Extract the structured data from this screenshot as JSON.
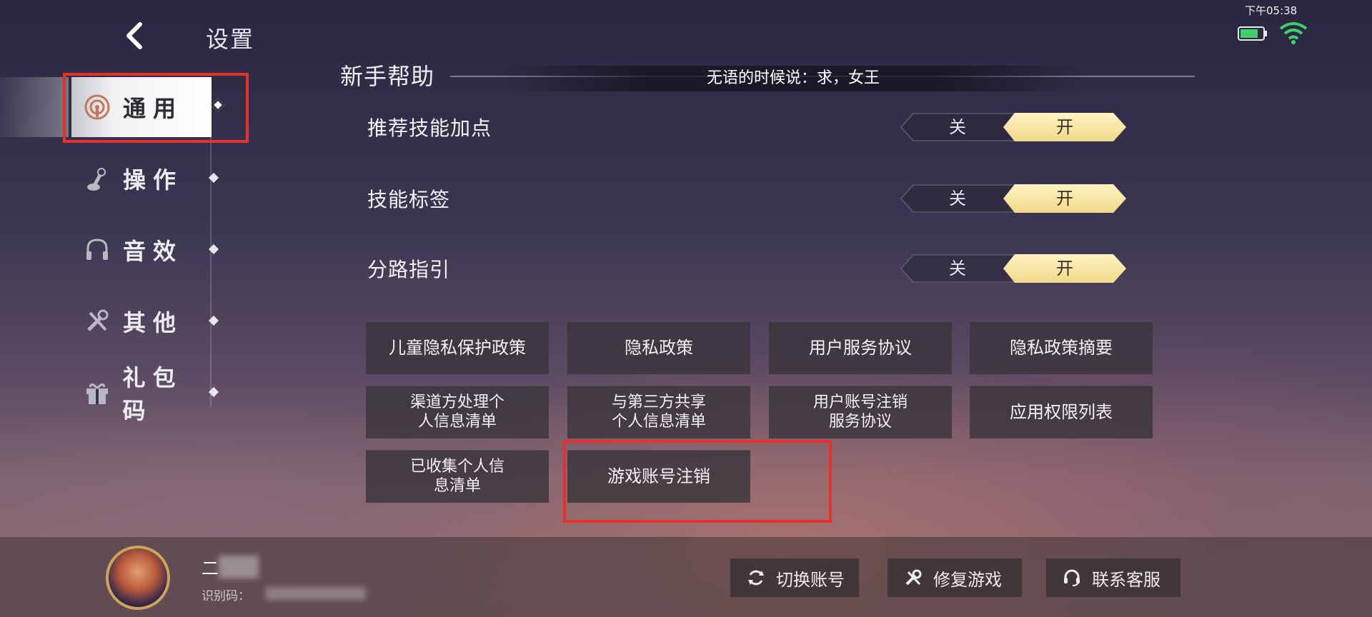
{
  "status_bar": {
    "time": "下午05:38"
  },
  "header": {
    "title": "设置"
  },
  "sidebar": {
    "items": [
      {
        "label": "通用",
        "icon": "general-icon",
        "active": true
      },
      {
        "label": "操作",
        "icon": "joystick-icon",
        "active": false
      },
      {
        "label": "音效",
        "icon": "headphones-icon",
        "active": false
      },
      {
        "label": "其他",
        "icon": "tools-icon",
        "active": false
      },
      {
        "label": "礼包码",
        "icon": "gift-icon",
        "active": false
      }
    ]
  },
  "main": {
    "section_title": "新手帮助",
    "tip": "无语的时候说：求，女王",
    "settings": [
      {
        "label": "推荐技能加点",
        "off": "关",
        "on": "开",
        "value": "开"
      },
      {
        "label": "技能标签",
        "off": "关",
        "on": "开",
        "value": "开"
      },
      {
        "label": "分路指引",
        "off": "关",
        "on": "开",
        "value": "开"
      }
    ],
    "docs": [
      {
        "line1": "儿童隐私保护政策",
        "line2": ""
      },
      {
        "line1": "隐私政策",
        "line2": ""
      },
      {
        "line1": "用户服务协议",
        "line2": ""
      },
      {
        "line1": "隐私政策摘要",
        "line2": ""
      },
      {
        "line1": "渠道方处理个",
        "line2": "人信息清单"
      },
      {
        "line1": "与第三方共享",
        "line2": "个人信息清单"
      },
      {
        "line1": "用户账号注销",
        "line2": "服务协议"
      },
      {
        "line1": "应用权限列表",
        "line2": ""
      },
      {
        "line1": "已收集个人信",
        "line2": "息清单"
      },
      {
        "line1": "游戏账号注销",
        "line2": ""
      }
    ]
  },
  "footer": {
    "user_name_prefix": "二",
    "user_id_label": "识别码：",
    "buttons": [
      {
        "label": "切换账号",
        "icon": "switch-account-icon"
      },
      {
        "label": "修复游戏",
        "icon": "repair-icon"
      },
      {
        "label": "联系客服",
        "icon": "customer-service-icon"
      }
    ]
  },
  "colors": {
    "toggle_on": "#f0d98a",
    "highlight": "#e8302c"
  }
}
